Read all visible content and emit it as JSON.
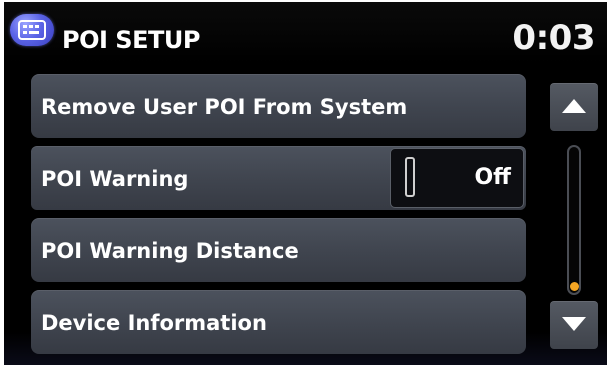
{
  "header": {
    "icon": "poi-setup-icon",
    "title": "POI SETUP",
    "clock": "0:03"
  },
  "menu": {
    "items": [
      {
        "label": "Remove User POI From System"
      },
      {
        "label": "POI Warning",
        "toggle_value": "Off"
      },
      {
        "label": "POI Warning Distance"
      },
      {
        "label": "Device Information"
      }
    ]
  },
  "scrollbar": {
    "up_icon": "triangle-up-icon",
    "down_icon": "triangle-down-icon",
    "thumb_color": "#f5a623",
    "position": 1.0
  },
  "colors": {
    "background": "#000000",
    "item": "#42474f",
    "accent": "#f5a623",
    "header_icon": "#5a63e6"
  }
}
